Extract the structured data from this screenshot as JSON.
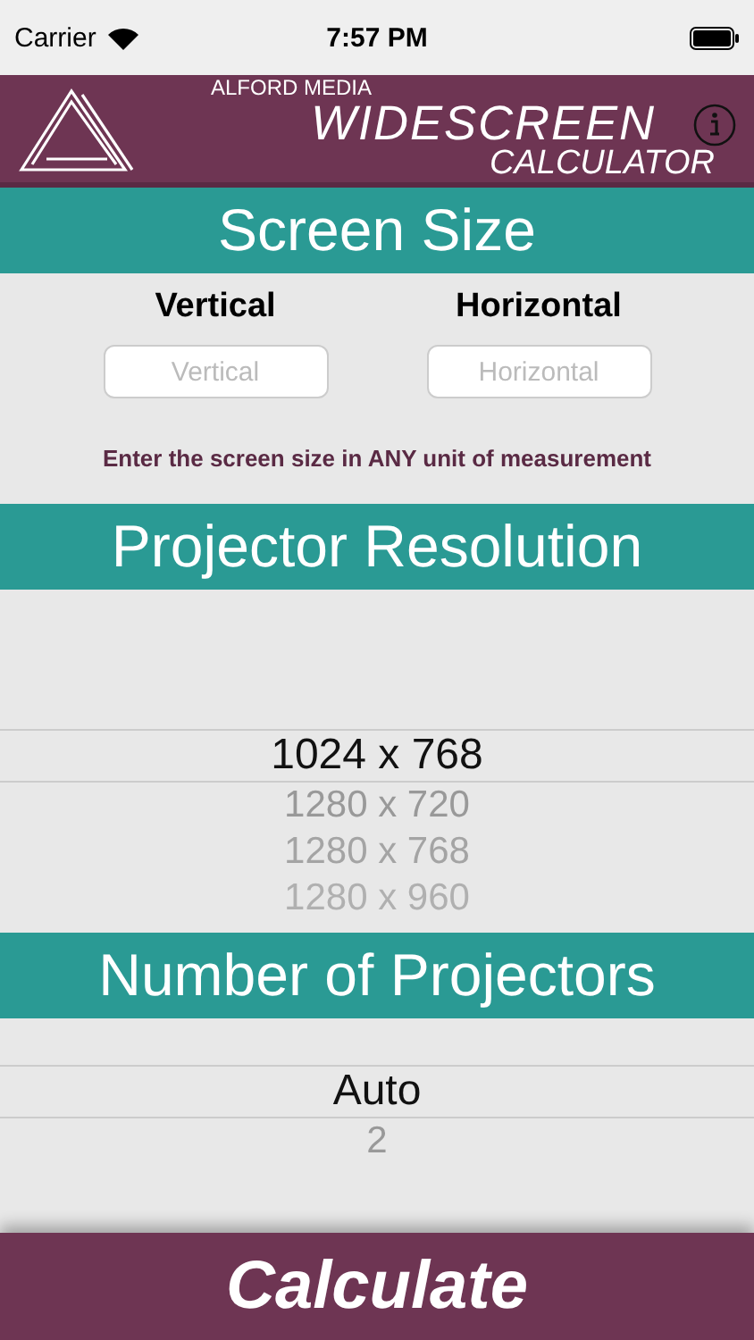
{
  "status_bar": {
    "carrier": "Carrier",
    "time": "7:57 PM"
  },
  "header": {
    "brand": "ALFORD MEDIA",
    "title": "WIDESCREEN",
    "subtitle": "CALCULATOR"
  },
  "sections": [
    {
      "kind": "fields",
      "title": "Screen Size",
      "fields": [
        {
          "label": "Vertical",
          "placeholder": "Vertical"
        },
        {
          "label": "Horizontal",
          "placeholder": "Horizontal"
        }
      ],
      "note": "Enter the screen size in ANY unit of measurement"
    },
    {
      "kind": "picker",
      "title": "Projector Resolution",
      "options": [
        {
          "label": "1024 x 768",
          "selected": true
        },
        {
          "label": "1280 x 720",
          "selected": false
        },
        {
          "label": "1280 x 768",
          "selected": false
        },
        {
          "label": "1280 x 960",
          "selected": false
        }
      ]
    },
    {
      "kind": "picker",
      "title": "Number of Projectors",
      "options": [
        {
          "label": "Auto",
          "selected": true
        },
        {
          "label": "2",
          "selected": false
        }
      ]
    }
  ],
  "button": "Calculate"
}
